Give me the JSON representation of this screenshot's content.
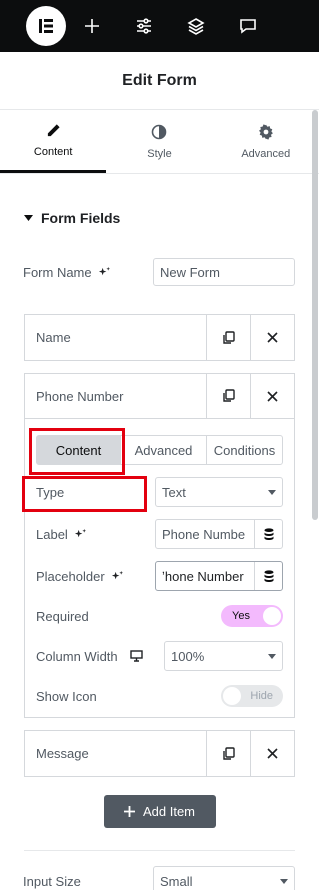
{
  "header": {
    "title": "Edit Form"
  },
  "tabs": [
    {
      "label": "Content",
      "icon": "pencil-icon",
      "active": true
    },
    {
      "label": "Style",
      "icon": "half-circle-icon",
      "active": false
    },
    {
      "label": "Advanced",
      "icon": "gear-icon",
      "active": false
    }
  ],
  "section": {
    "title": "Form Fields"
  },
  "form_name": {
    "label": "Form Name",
    "value": "New Form"
  },
  "fields": [
    {
      "title": "Name"
    },
    {
      "title": "Phone Number"
    },
    {
      "title": "Message"
    }
  ],
  "field_tabs": [
    "Content",
    "Advanced",
    "Conditions"
  ],
  "field_controls": {
    "type_label": "Type",
    "type_value": "Text",
    "label_label": "Label",
    "label_value": "Phone Numbe",
    "placeholder_label": "Placeholder",
    "placeholder_value": "ʼhone Number",
    "required_label": "Required",
    "required_value": "Yes",
    "column_width_label": "Column Width",
    "column_width_value": "100%",
    "show_icon_label": "Show Icon",
    "show_icon_value": "Hide"
  },
  "add_item": {
    "label": "Add Item"
  },
  "input_size": {
    "label": "Input Size",
    "value": "Small"
  },
  "colors": {
    "accent": "#f3bafd",
    "highlight": "#e3000f",
    "dark": "#0c0d0e"
  }
}
